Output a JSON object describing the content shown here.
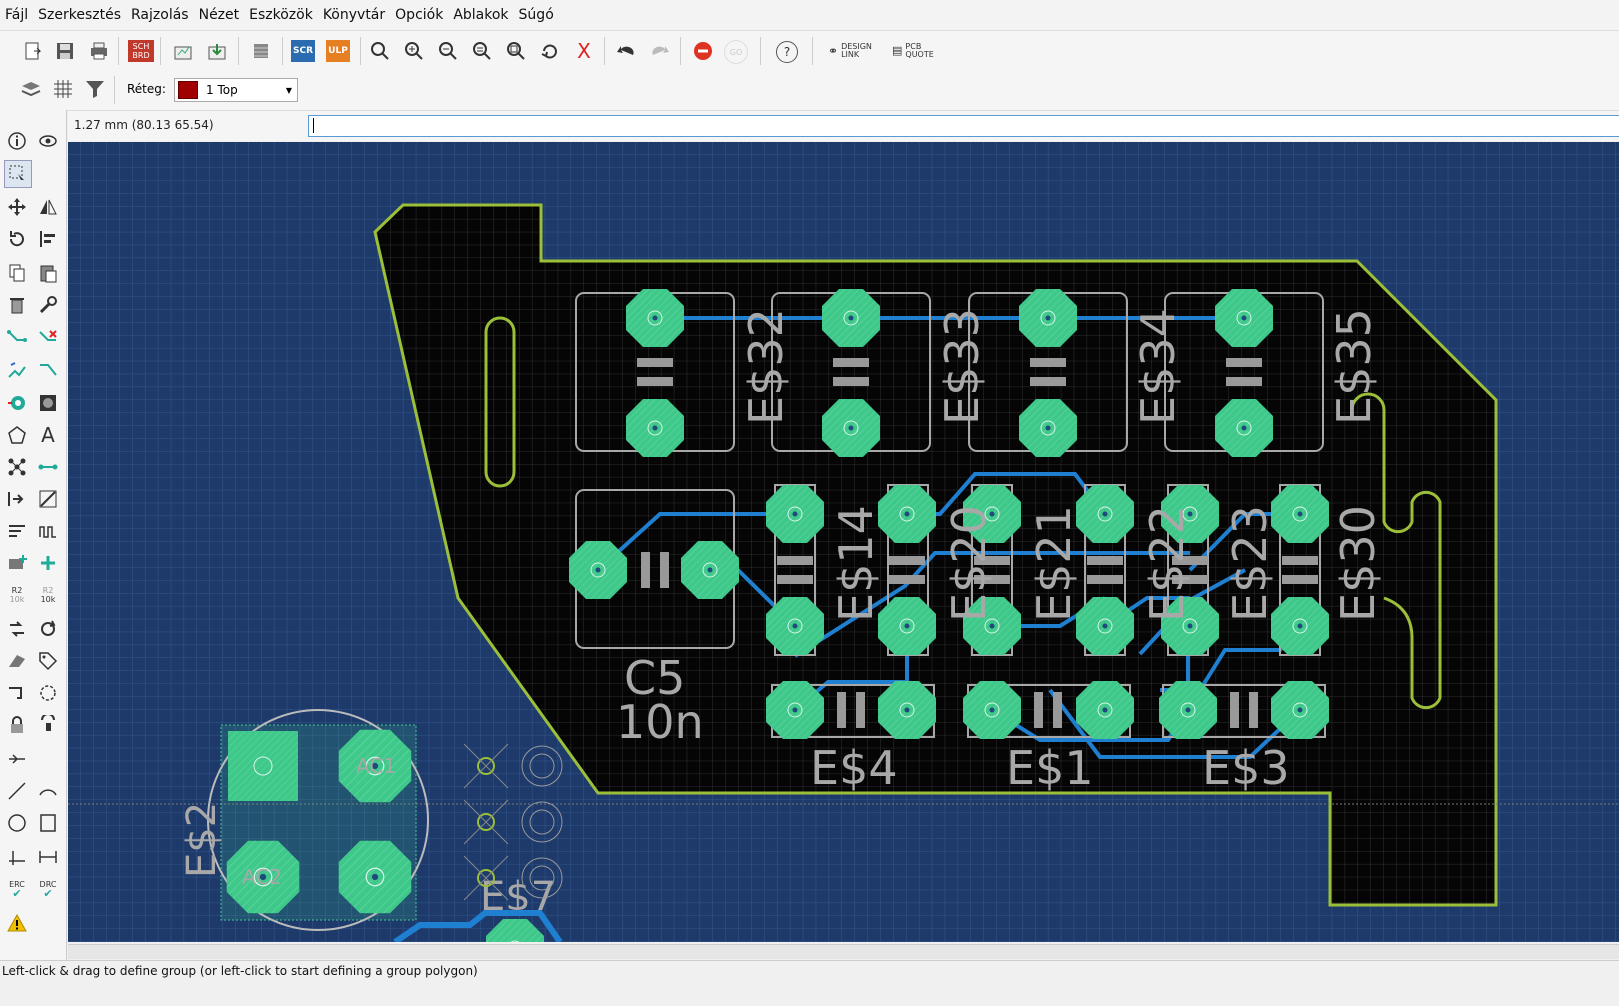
{
  "menu": [
    "Fájl",
    "Szerkesztés",
    "Rajzolás",
    "Nézet",
    "Eszközök",
    "Könyvtár",
    "Opciók",
    "Ablakok",
    "Súgó"
  ],
  "toolbar": {
    "sch_label": "SCH",
    "brd_label": "BRD",
    "scr_label": "SCR",
    "ulp_label": "ULP",
    "go_label": "GO",
    "help_label": "?",
    "design_link": "DESIGN LINK",
    "pcb_quote": "PCB QUOTE"
  },
  "layer_bar": {
    "label": "Réteg:",
    "layer": "1 Top"
  },
  "command": {
    "coord": "1.27 mm (80.13 65.54)",
    "input": ""
  },
  "left_tools": {
    "r2_a": "R2",
    "k10_a": "10k",
    "r2_b": "R2",
    "k10_b": "10k",
    "erc": "ERC",
    "drc": "DRC"
  },
  "status": "Left-click & drag to define group (or left-click to start defining a group polygon)",
  "pcb": {
    "parts_top": [
      "E$32",
      "E$33",
      "E$34",
      "E$35"
    ],
    "parts_mid": [
      "E$14",
      "E$20",
      "E$21",
      "E$22",
      "E$23",
      "E$30"
    ],
    "parts_bottom": [
      "E$4",
      "E$1",
      "E$3"
    ],
    "cap_name": "C5",
    "cap_value": "10n",
    "left_parts": [
      "E$2",
      "E$7"
    ],
    "pad_labels": {
      "ac1": "AC1",
      "ac2": "AC2"
    }
  },
  "colors": {
    "canvas_bg": "#1d3a6b",
    "board": "#000000",
    "outline": "#9cbf3a",
    "pad": "#3ec98a",
    "trace": "#1f7fd0",
    "silk": "#a8a8a8"
  }
}
